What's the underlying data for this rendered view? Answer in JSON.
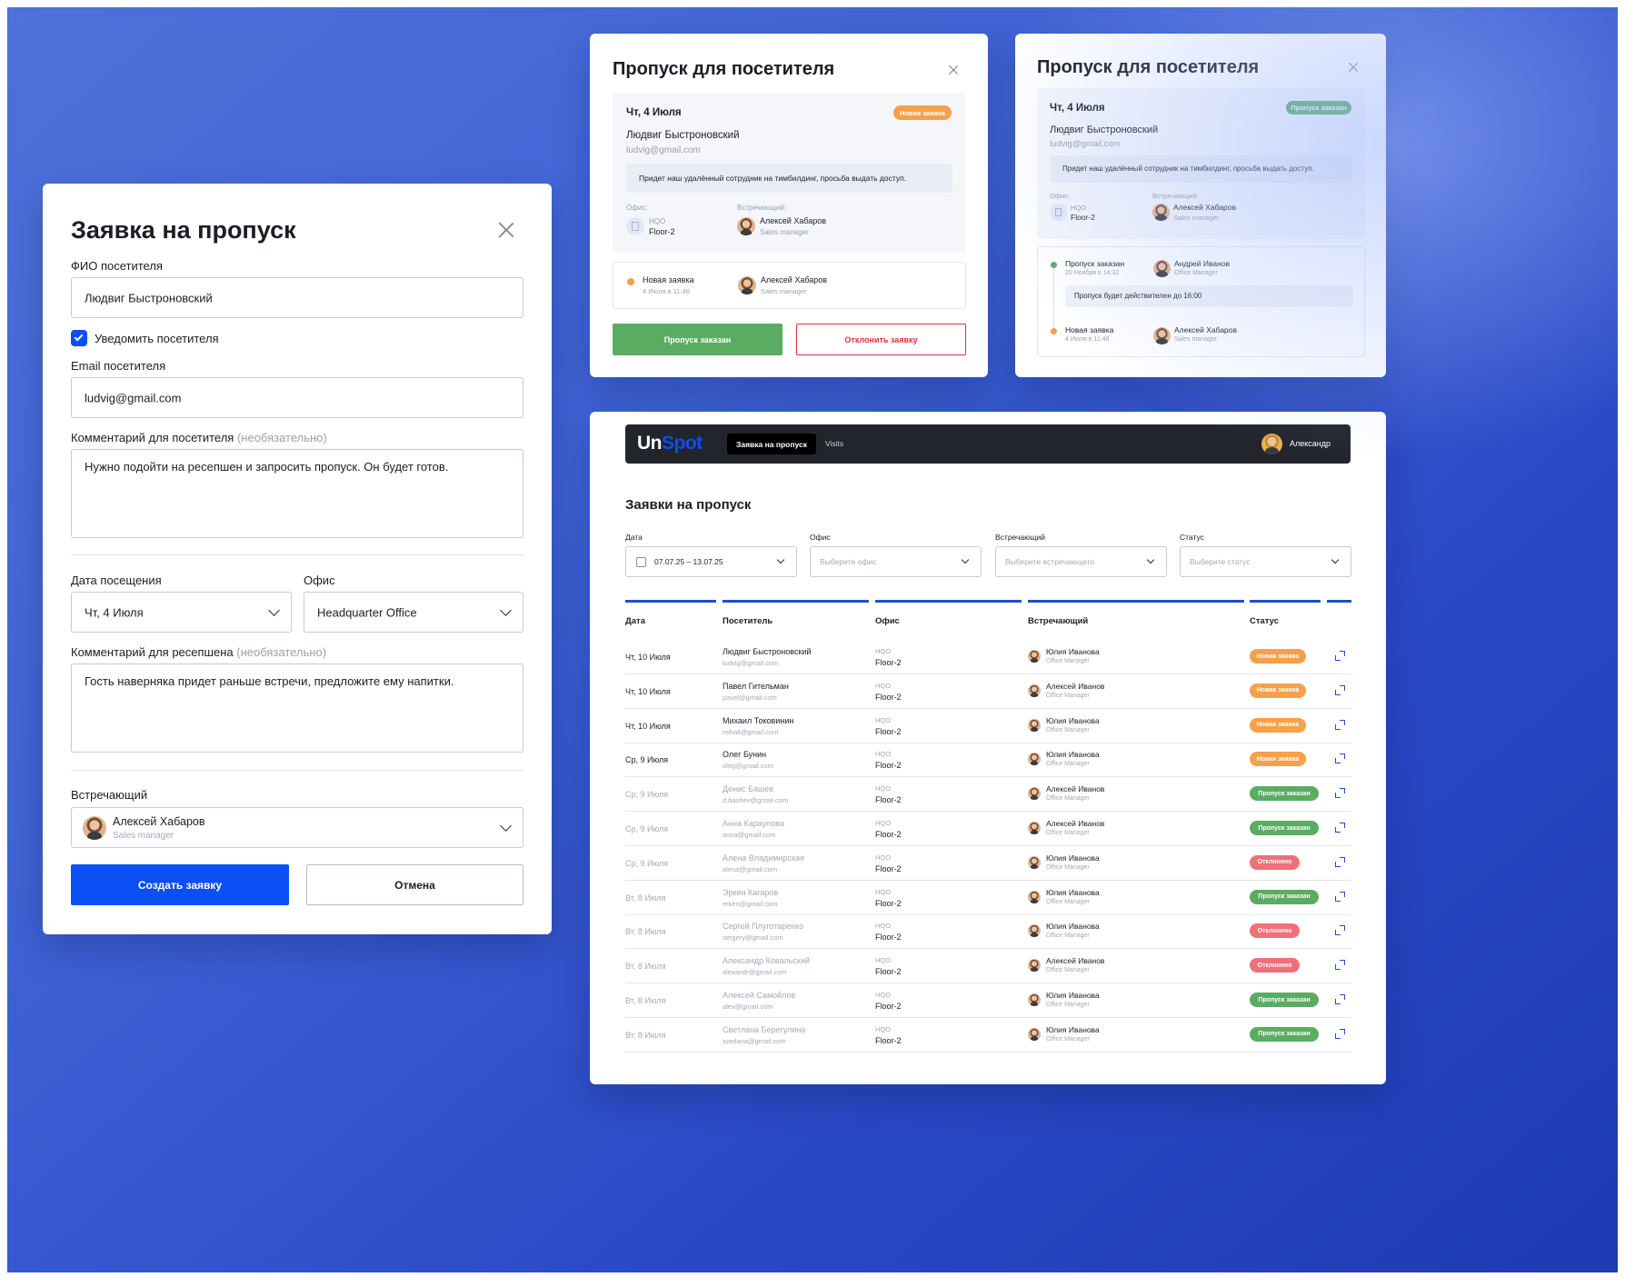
{
  "form": {
    "title": "Заявка на пропуск",
    "fio_label": "ФИО посетителя",
    "fio_value": "Людвиг Быстроновский",
    "notify_label": "Уведомить посетителя",
    "email_label": "Email посетителя",
    "email_value": "ludvig@gmail.com",
    "comment_label": "Комментарий для посетителя",
    "optional": "(необязательно)",
    "comment_value": "Нужно подойти на ресепшен и запросить пропуск. Он будет готов.",
    "date_label": "Дата посещения",
    "date_value": "Чт, 4 Июля",
    "office_label": "Офис",
    "office_value": "Headquarter Office",
    "reception_label": "Комментарий для ресепшена",
    "reception_value": "Гость наверняка придет раньше встречи, предложите ему напитки.",
    "host_label": "Встречающий",
    "host_name": "Алексей Хабаров",
    "host_role": "Sales manager",
    "create_button": "Создать заявку",
    "cancel_button": "Отмена"
  },
  "pass1": {
    "title": "Пропуск для посетителя",
    "date": "Чт, 4 Июля",
    "badge": "Новая заявка",
    "name": "Людвиг Быстроновский",
    "email": "ludvig@gmail.com",
    "message": "Придет наш удалённый сотрудник на тимбилдинг, просьба выдать доступ.",
    "office_label": "Офис:",
    "host_label": "Встречающий:",
    "office_code": "HQO",
    "office_floor": "Floor-2",
    "host_name": "Алексей Хабаров",
    "host_role": "Sales manager",
    "history_status": "Новая заявка",
    "history_time": "4 Июля в 11:48",
    "history_host": "Алексей Хабаров",
    "history_role": "Sales manager",
    "approve_button": "Пропуск заказан",
    "reject_button": "Отклонить заявку"
  },
  "pass2": {
    "title": "Пропуск для посетителя",
    "date": "Чт, 4 Июля",
    "badge": "Пропуск заказан",
    "name": "Людвиг Быстроновский",
    "email": "ludvig@gmail.com",
    "message": "Придет наш удалённый сотрудник на тимбилдинг, просьба выдать доступ.",
    "office_label": "Офис:",
    "host_label": "Встречающий:",
    "office_code": "HQO",
    "office_floor": "Floor-2",
    "host_name": "Алексей Хабаров",
    "host_role": "Sales manager",
    "h1_status": "Пропуск заказан",
    "h1_time": "20 Ноября в 14:32",
    "h1_host": "Андрей Иванов",
    "h1_role": "Office Manager",
    "h1_note": "Пропуск будет действителен до 16:00",
    "h2_status": "Новая заявка",
    "h2_time": "4 Июля в 11:48",
    "h2_host": "Алексей Хабаров",
    "h2_role": "Sales manager"
  },
  "app": {
    "logo_a": "Un",
    "logo_b": "Spot",
    "nav_active": "Заявка на пропуск",
    "nav_other": "Visits",
    "user": "Александр",
    "page_title": "Заявки на пропуск",
    "filters": [
      {
        "label": "Дата",
        "value": "07.07.25 – 13.07.25"
      },
      {
        "label": "Офис",
        "value": "Выберите офис"
      },
      {
        "label": "Встречающий",
        "value": "Выберите встречающего"
      },
      {
        "label": "Статус",
        "value": "Выберите статус"
      }
    ],
    "columns": [
      "Дата",
      "Посетитель",
      "Офис",
      "Встречающий",
      "Статус"
    ],
    "rows": [
      {
        "date": "Чт, 10 Июля",
        "name": "Людвиг Быстроновский",
        "email": "ludvig@gmail.com",
        "office": "HQO",
        "floor": "Floor-2",
        "host": "Юлия Иванова",
        "role": "Office Manager",
        "status": "Новая заявка"
      },
      {
        "date": "Чт, 10 Июля",
        "name": "Павел Гительман",
        "email": "pavel@gmail.com",
        "office": "HQO",
        "floor": "Floor-2",
        "host": "Алексей Иванов",
        "role": "Office Manager",
        "status": "Новая заявка"
      },
      {
        "date": "Чт, 10 Июля",
        "name": "Михаил Токовинин",
        "email": "mihail@gmail.com",
        "office": "HQO",
        "floor": "Floor-2",
        "host": "Юлия Иванова",
        "role": "Office Manager",
        "status": "Новая заявка"
      },
      {
        "date": "Ср, 9 Июля",
        "name": "Олег Бунин",
        "email": "oleg@gmail.com",
        "office": "HQO",
        "floor": "Floor-2",
        "host": "Юлия Иванова",
        "role": "Office Manager",
        "status": "Новая заявка"
      },
      {
        "date": "Ср, 9 Июля",
        "name": "Денис Башев",
        "email": "d.bashev@gmail.com",
        "office": "HQO",
        "floor": "Floor-2",
        "host": "Алексей Иванов",
        "role": "Office Manager",
        "status": "Пропуск заказан"
      },
      {
        "date": "Ср, 9 Июля",
        "name": "Анна Караулова",
        "email": "anna@gmail.com",
        "office": "HQO",
        "floor": "Floor-2",
        "host": "Алексей Иванов",
        "role": "Office Manager",
        "status": "Пропуск заказан"
      },
      {
        "date": "Ср, 9 Июля",
        "name": "Алена Владимирская",
        "email": "alena@gmail.com",
        "office": "HQO",
        "floor": "Floor-2",
        "host": "Юлия Иванова",
        "role": "Office Manager",
        "status": "Отклонено"
      },
      {
        "date": "Вт, 8 Июля",
        "name": "Эркен Кагаров",
        "email": "erken@gmail.com",
        "office": "HQO",
        "floor": "Floor-2",
        "host": "Юлия Иванова",
        "role": "Office Manager",
        "status": "Пропуск заказан"
      },
      {
        "date": "Вт, 8 Июля",
        "name": "Сергей Плуготаренко",
        "email": "sergery@gmail.com",
        "office": "HQO",
        "floor": "Floor-2",
        "host": "Юлия Иванова",
        "role": "Office Manager",
        "status": "Отклонено"
      },
      {
        "date": "Вт, 8 Июля",
        "name": "Александр Ковальский",
        "email": "alexandr@gmail.com",
        "office": "HQO",
        "floor": "Floor-2",
        "host": "Алексей Иванов",
        "role": "Office Manager",
        "status": "Отклонено"
      },
      {
        "date": "Вт, 8 Июля",
        "name": "Алексей Самойлов",
        "email": "alex@gmail.com",
        "office": "HQO",
        "floor": "Floor-2",
        "host": "Юлия Иванова",
        "role": "Office Manager",
        "status": "Пропуск заказан"
      },
      {
        "date": "Вт, 8 Июля",
        "name": "Светлана Берегулина",
        "email": "svetlana@gmail.com",
        "office": "HQO",
        "floor": "Floor-2",
        "host": "Юлия Иванова",
        "role": "Office Manager",
        "status": "Пропуск заказан"
      }
    ]
  },
  "colors": {
    "primary": "#0b4ff5",
    "new": "#f5a04a",
    "ordered": "#5aac62",
    "rejected": "#f0707a",
    "reject_text": "#e0303c",
    "dark": "#22252c"
  }
}
